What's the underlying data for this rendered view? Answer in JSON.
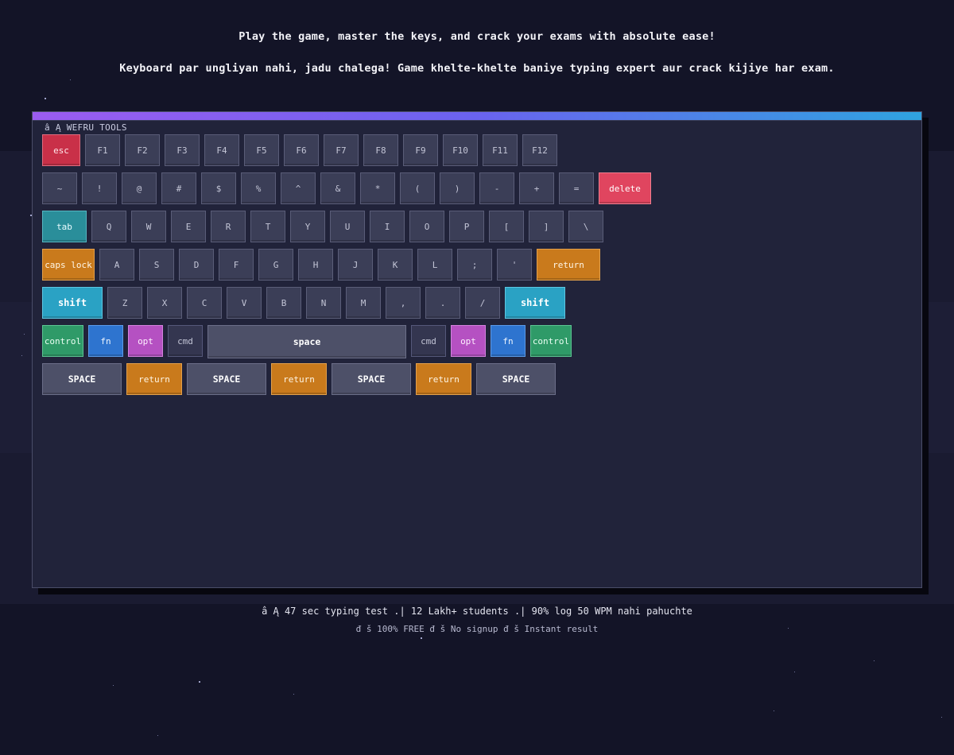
{
  "tagline": {
    "line1": "Play the game, master the keys, and crack your exams with absolute ease!",
    "line2": "Keyboard par ungliyan nahi, jadu chalega! Game khelte-khelte baniye typing expert aur crack kijiye har exam."
  },
  "panel": {
    "title": "â Ą WEFRU TOOLS"
  },
  "keys": {
    "fn_row": [
      "esc",
      "F1",
      "F2",
      "F3",
      "F4",
      "F5",
      "F6",
      "F7",
      "F8",
      "F9",
      "F10",
      "F11",
      "F12"
    ],
    "num_row": [
      "~",
      "!",
      "@",
      "#",
      "$",
      "%",
      "^",
      "&",
      "*",
      "(",
      ")",
      "-",
      "+",
      "=",
      "delete"
    ],
    "tab_row": [
      "tab",
      "Q",
      "W",
      "E",
      "R",
      "T",
      "Y",
      "U",
      "I",
      "O",
      "P",
      "[",
      "]",
      "\\"
    ],
    "caps_row": [
      "caps lock",
      "A",
      "S",
      "D",
      "F",
      "G",
      "H",
      "J",
      "K",
      "L",
      ";",
      "'",
      "return"
    ],
    "shift_row": [
      "shift",
      "Z",
      "X",
      "C",
      "V",
      "B",
      "N",
      "M",
      ",",
      ".",
      "/",
      "shift"
    ],
    "mod_row": [
      "control",
      "fn",
      "opt",
      "cmd",
      "space",
      "cmd",
      "opt",
      "fn",
      "control"
    ],
    "extra_row": [
      "SPACE",
      "return",
      "SPACE",
      "return",
      "SPACE",
      "return",
      "SPACE"
    ]
  },
  "footer": {
    "line1": "â Ą 47 sec typing test .|  12 Lakh+ students .|  90% log 50 WPM nahi pahuchte",
    "line2": "đ  š 100% FREE  đ  š  No signup  đ  š  Instant result"
  },
  "colors": {
    "background": "#131427",
    "panel": "#21233a",
    "esc": "#c93048",
    "delete": "#e0455f",
    "tab": "#2a8e9a",
    "caps_return": "#c97a1c",
    "shift": "#2aa2c4",
    "control": "#2f9a68",
    "fn": "#2e74cf",
    "opt": "#b551c2"
  }
}
